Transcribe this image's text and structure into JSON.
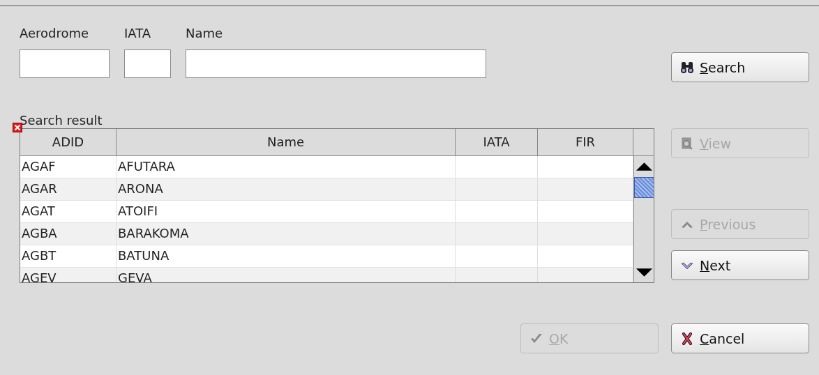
{
  "search_fields": [
    {
      "label": "Aerodrome"
    },
    {
      "label": "IATA"
    },
    {
      "label": "Name"
    }
  ],
  "search_button": {
    "mnemonic": "S",
    "rest": "earch",
    "disabled": false
  },
  "result": {
    "label": "Search result",
    "error": true,
    "columns": [
      "ADID",
      "Name",
      "IATA",
      "FIR"
    ],
    "rows": [
      [
        "AGAF",
        "AFUTARA",
        "",
        ""
      ],
      [
        "AGAR",
        "ARONA",
        "",
        ""
      ],
      [
        "AGAT",
        "ATOIFI",
        "",
        ""
      ],
      [
        "AGBA",
        "BARAKOMA",
        "",
        ""
      ],
      [
        "AGBT",
        "BATUNA",
        "",
        ""
      ],
      [
        "AGEV",
        "GEVA",
        "",
        ""
      ]
    ]
  },
  "side_buttons": [
    {
      "mnemonic": "V",
      "rest": "iew",
      "disabled": true
    },
    {
      "mnemonic": "P",
      "rest": "revious",
      "disabled": true
    },
    {
      "mnemonic": "N",
      "rest": "ext",
      "disabled": false
    }
  ],
  "dialog_buttons": [
    {
      "mnemonic": "O",
      "rest": "K",
      "disabled": true
    },
    {
      "mnemonic": "C",
      "rest": "ancel",
      "disabled": false
    }
  ]
}
